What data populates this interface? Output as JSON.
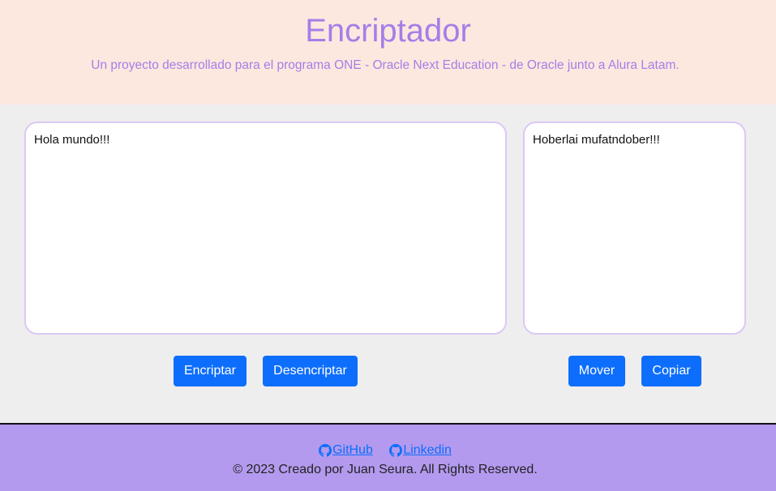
{
  "header": {
    "title": "Encriptador",
    "subtitle": "Un proyecto desarrollado para el programa ONE - Oracle Next Education - de Oracle junto a Alura Latam."
  },
  "main": {
    "input_value": "Hola mundo!!!",
    "output_value": "Hoberlai mufatndober!!!",
    "encrypt_label": "Encriptar",
    "decrypt_label": "Desencriptar",
    "move_label": "Mover",
    "copy_label": "Copiar"
  },
  "footer": {
    "github_label": "GitHub",
    "linkedin_label": "Linkedin",
    "copyright": "© 2023 Creado por Juan Seura. All Rights Reserved."
  },
  "colors": {
    "header_bg": "#fde8df",
    "accent_purple": "#a57ee8",
    "footer_bg": "#b39aee",
    "button_blue": "#0d6efd",
    "main_bg": "#eeeeee"
  },
  "icons": {
    "github": "github-icon"
  }
}
